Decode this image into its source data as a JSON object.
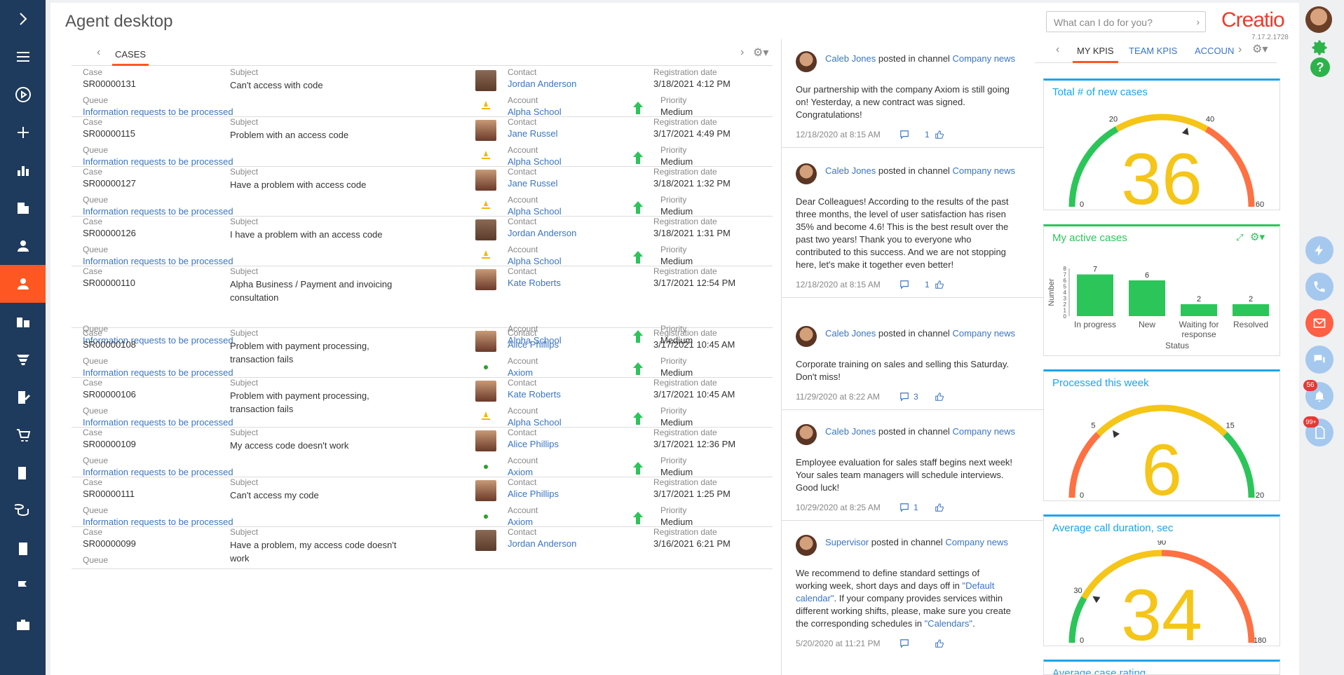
{
  "page": {
    "title": "Agent desktop"
  },
  "header": {
    "search_placeholder": "What can I do for you?",
    "logo": "Creatio",
    "version": "7.17.2.1728"
  },
  "colors": {
    "nav_bg": "#1e3a5c",
    "accent": "#ff5722",
    "link": "#3a75c3",
    "kpi": "#1ea4e9",
    "green": "#2cc55a"
  },
  "nav": {
    "items": [
      "chevron-right-icon",
      "menu-icon",
      "play-icon",
      "plus-icon",
      "bar-chart-icon",
      "building-icon",
      "user-icon",
      "agent-icon",
      "accounts-icon",
      "funnel-icon",
      "document-edit-icon",
      "cart-icon",
      "contract-icon",
      "coins-icon",
      "invoice-icon",
      "flag-icon",
      "briefcase-icon"
    ]
  },
  "cases": {
    "tab": "CASES",
    "labels": {
      "case": "Case",
      "subject": "Subject",
      "queue": "Queue",
      "contact": "Contact",
      "account": "Account",
      "reg_date": "Registration date",
      "priority": "Priority"
    },
    "rows": [
      {
        "case": "SR00000131",
        "subject": "Can't access with code",
        "queue": "Information requests to be processed",
        "contact": "Jordan Anderson",
        "account": "Alpha School",
        "date": "3/18/2021 4:12 PM",
        "priority": "Medium"
      },
      {
        "case": "SR00000115",
        "subject": "Problem with an access code",
        "queue": "Information requests to be processed",
        "contact": "Jane Russel",
        "account": "Alpha School",
        "date": "3/17/2021 4:49 PM",
        "priority": "Medium"
      },
      {
        "case": "SR00000127",
        "subject": "Have a problem with access code",
        "queue": "Information requests to be processed",
        "contact": "Jane Russel",
        "account": "Alpha School",
        "date": "3/18/2021 1:32 PM",
        "priority": "Medium"
      },
      {
        "case": "SR00000126",
        "subject": "I have a problem with an access code",
        "queue": "Information requests to be processed",
        "contact": "Jordan Anderson",
        "account": "Alpha School",
        "date": "3/18/2021 1:31 PM",
        "priority": "Medium"
      },
      {
        "case": "SR00000110",
        "subject": "Alpha Business / Payment and invoicing consultation",
        "queue": "Information requests to be processed",
        "contact": "Kate Roberts",
        "account": "Alpha School",
        "date": "3/17/2021 12:54 PM",
        "priority": "Medium"
      },
      {
        "case": "SR00000108",
        "subject": "Problem with payment processing, transaction fails",
        "queue": "Information requests to be processed",
        "contact": "Alice Phillips",
        "account": "Axiom",
        "date": "3/17/2021 10:45 AM",
        "priority": "Medium"
      },
      {
        "case": "SR00000106",
        "subject": "Problem with payment processing, transaction fails",
        "queue": "Information requests to be processed",
        "contact": "Kate Roberts",
        "account": "Alpha School",
        "date": "3/17/2021 10:45 AM",
        "priority": "Medium"
      },
      {
        "case": "SR00000109",
        "subject": "My access code doesn't work",
        "queue": "Information requests to be processed",
        "contact": "Alice Phillips",
        "account": "Axiom",
        "date": "3/17/2021 12:36 PM",
        "priority": "Medium"
      },
      {
        "case": "SR00000111",
        "subject": "Can't access my code",
        "queue": "Information requests to be processed",
        "contact": "Alice Phillips",
        "account": "Axiom",
        "date": "3/17/2021 1:25 PM",
        "priority": "Medium"
      },
      {
        "case": "SR00000099",
        "subject": "Have a problem, my access code doesn't work",
        "queue": "",
        "contact": "Jordan Anderson",
        "account": "",
        "date": "3/16/2021 6:21 PM",
        "priority": ""
      }
    ]
  },
  "feed": {
    "posted_in": "posted in channel",
    "posts": [
      {
        "author": "Caleb Jones",
        "channel": "Company news",
        "text": "Our partnership with the company Axiom is still going on! Yesterday, a new contract was signed. Congratulations!",
        "date": "12/18/2020 at 8:15 AM",
        "comments": "",
        "likes": "1"
      },
      {
        "author": "Caleb Jones",
        "channel": "Company news",
        "text": "Dear Colleagues! According to the results of the past three months, the level of user satisfaction has risen 35% and become 4.6! This is the best result over the past two years! Thank you to everyone who contributed to this success. And we are not stopping here, let's make it together even better!",
        "date": "12/18/2020 at 8:15 AM",
        "comments": "",
        "likes": "1"
      },
      {
        "author": "Caleb Jones",
        "channel": "Company news",
        "text": "Corporate training on sales and selling this Saturday. Don't miss!",
        "date": "11/29/2020 at 8:22 AM",
        "comments": "3",
        "likes": ""
      },
      {
        "author": "Caleb Jones",
        "channel": "Company news",
        "text": "Employee evaluation for sales staff begins next week! Your sales team managers will schedule interviews. Good luck!",
        "date": "10/29/2020 at 8:25 AM",
        "comments": "1",
        "likes": ""
      },
      {
        "author": "Supervisor",
        "channel": "Company news",
        "text_a": "We recommend to define standard settings of working week, short days and days off in ",
        "link_a": "\"Default calendar\"",
        "text_b": ". If your company provides services within different working shifts, please, make sure you create the corresponding schedules in ",
        "link_b": "\"Calendars\"",
        "text_c": ".",
        "date": "5/20/2020 at 11:21 PM",
        "comments": "",
        "likes": ""
      }
    ]
  },
  "kpi": {
    "tabs": [
      "MY KPIS",
      "TEAM KPIS",
      "ACCOUN"
    ],
    "gauges": [
      {
        "title": "Total # of new cases",
        "value": 36,
        "min": 0,
        "max": 60,
        "t1": 20,
        "t2": 40,
        "colors": [
          "#2cc55a",
          "#f5c518",
          "#ff7043"
        ]
      },
      {
        "title": "Processed this week",
        "value": 6,
        "min": 0,
        "max": 20,
        "t1": 5,
        "t2": 15,
        "colors": [
          "#ff7043",
          "#f5c518",
          "#2cc55a"
        ]
      },
      {
        "title": "Average call duration, sec",
        "value": 34,
        "min": 0,
        "max": 180,
        "t1": 30,
        "t2": 90,
        "colors": [
          "#2cc55a",
          "#f5c518",
          "#ff7043"
        ]
      }
    ],
    "next_title": "Average case rating",
    "active_cases": {
      "title": "My active cases",
      "chart_data": {
        "type": "bar",
        "categories": [
          "In progress",
          "New",
          "Waiting for response",
          "Resolved"
        ],
        "values": [
          7,
          6,
          2,
          2
        ],
        "ylabel": "Number",
        "xlabel": "Status",
        "ylim": [
          0,
          8
        ],
        "yticks": [
          "0",
          "1",
          "2",
          "3",
          "4",
          "5",
          "6",
          "7",
          "8"
        ]
      }
    }
  },
  "notifications": {
    "bell_count": "56",
    "doc_count": "99+"
  }
}
